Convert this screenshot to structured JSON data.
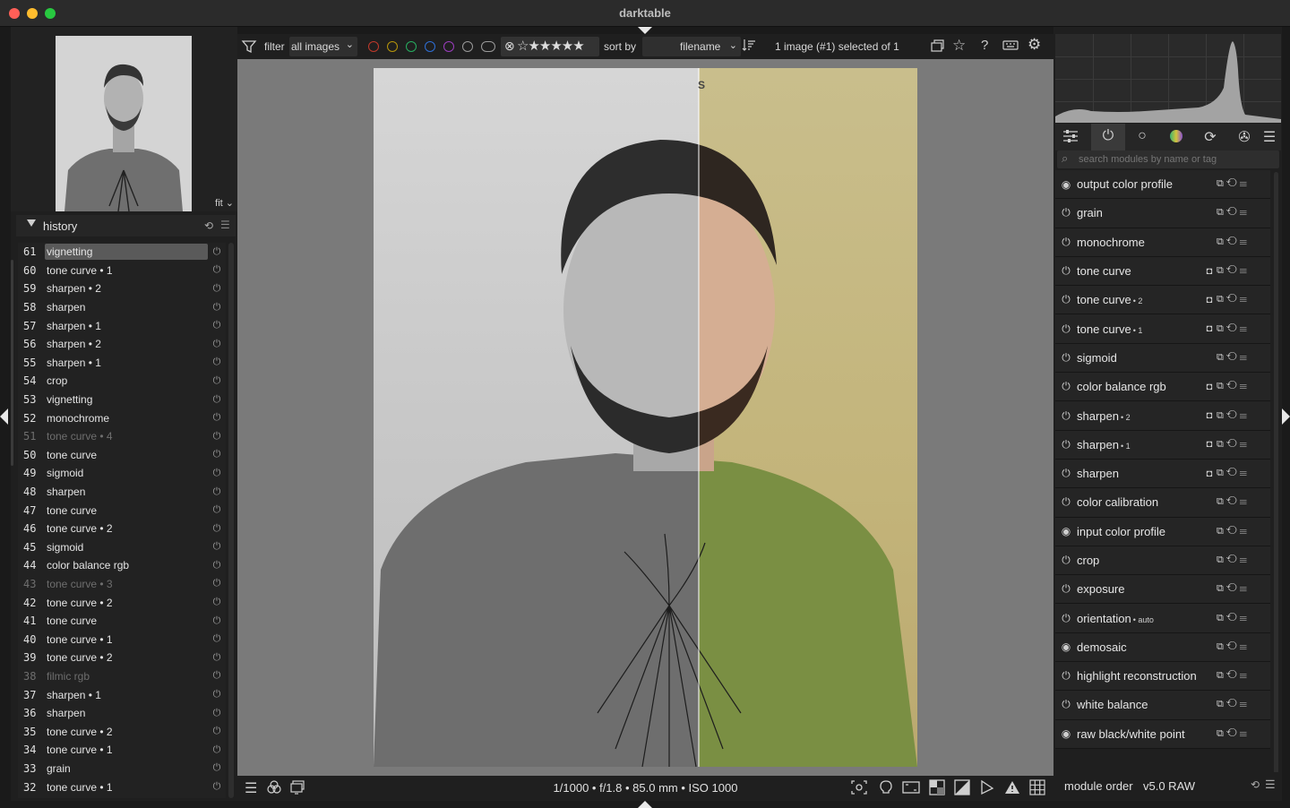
{
  "window": {
    "title": "darktable"
  },
  "navigator": {
    "zoom": "fit"
  },
  "history": {
    "title": "history",
    "items": [
      {
        "num": "61",
        "label": "vignetting",
        "state": "sel"
      },
      {
        "num": "60",
        "label": "tone curve • 1",
        "state": ""
      },
      {
        "num": "59",
        "label": "sharpen • 2",
        "state": ""
      },
      {
        "num": "58",
        "label": "sharpen",
        "state": ""
      },
      {
        "num": "57",
        "label": "sharpen • 1",
        "state": ""
      },
      {
        "num": "56",
        "label": "sharpen • 2",
        "state": ""
      },
      {
        "num": "55",
        "label": "sharpen • 1",
        "state": ""
      },
      {
        "num": "54",
        "label": "crop",
        "state": ""
      },
      {
        "num": "53",
        "label": "vignetting",
        "state": ""
      },
      {
        "num": "52",
        "label": "monochrome",
        "state": ""
      },
      {
        "num": "51",
        "label": "tone curve • 4",
        "state": "dim"
      },
      {
        "num": "50",
        "label": "tone curve",
        "state": ""
      },
      {
        "num": "49",
        "label": "sigmoid",
        "state": ""
      },
      {
        "num": "48",
        "label": "sharpen",
        "state": ""
      },
      {
        "num": "47",
        "label": "tone curve",
        "state": ""
      },
      {
        "num": "46",
        "label": "tone curve • 2",
        "state": ""
      },
      {
        "num": "45",
        "label": "sigmoid",
        "state": ""
      },
      {
        "num": "44",
        "label": "color balance rgb",
        "state": ""
      },
      {
        "num": "43",
        "label": "tone curve • 3",
        "state": "dim"
      },
      {
        "num": "42",
        "label": "tone curve • 2",
        "state": ""
      },
      {
        "num": "41",
        "label": "tone curve",
        "state": ""
      },
      {
        "num": "40",
        "label": "tone curve • 1",
        "state": ""
      },
      {
        "num": "39",
        "label": "tone curve • 2",
        "state": ""
      },
      {
        "num": "38",
        "label": "filmic rgb",
        "state": "dim"
      },
      {
        "num": "37",
        "label": "sharpen • 1",
        "state": ""
      },
      {
        "num": "36",
        "label": "sharpen",
        "state": ""
      },
      {
        "num": "35",
        "label": "tone curve • 2",
        "state": ""
      },
      {
        "num": "34",
        "label": "tone curve • 1",
        "state": ""
      },
      {
        "num": "33",
        "label": "grain",
        "state": ""
      },
      {
        "num": "32",
        "label": "tone curve • 1",
        "state": ""
      }
    ]
  },
  "toolbar": {
    "filter_label": "filter",
    "filter_value": "all images",
    "color_labels": [
      "#c0392b",
      "#b7950b",
      "#27ae60",
      "#2e6fd6",
      "#9b3dbf",
      "#9a9a9a",
      "#9a9a9a"
    ],
    "rating_stars": "☆★★★★★",
    "sortby_label": "sort by",
    "sort_value": "filename",
    "selection_status": "1 image (#1) selected of 1"
  },
  "image": {
    "split_label": "S"
  },
  "bottom_bar": {
    "exif": "1/1000 • f/1.8 • 85.0 mm • ISO 1000"
  },
  "search": {
    "placeholder": "search modules by name or tag"
  },
  "modules": [
    {
      "name": "output color profile",
      "inst": "",
      "always_on": true,
      "mask": false
    },
    {
      "name": "grain",
      "inst": "",
      "always_on": false,
      "mask": false
    },
    {
      "name": "monochrome",
      "inst": "",
      "always_on": false,
      "mask": false
    },
    {
      "name": "tone curve",
      "inst": "",
      "always_on": false,
      "mask": true
    },
    {
      "name": "tone curve",
      "inst": "• 2",
      "always_on": false,
      "mask": true
    },
    {
      "name": "tone curve",
      "inst": "• 1",
      "always_on": false,
      "mask": true
    },
    {
      "name": "sigmoid",
      "inst": "",
      "always_on": false,
      "mask": false
    },
    {
      "name": "color balance rgb",
      "inst": "",
      "always_on": false,
      "mask": true
    },
    {
      "name": "sharpen",
      "inst": "• 2",
      "always_on": false,
      "mask": true
    },
    {
      "name": "sharpen",
      "inst": "• 1",
      "always_on": false,
      "mask": true
    },
    {
      "name": "sharpen",
      "inst": "",
      "always_on": false,
      "mask": true
    },
    {
      "name": "color calibration",
      "inst": "",
      "always_on": false,
      "mask": false
    },
    {
      "name": "input color profile",
      "inst": "",
      "always_on": true,
      "mask": false
    },
    {
      "name": "crop",
      "inst": "",
      "always_on": false,
      "mask": false
    },
    {
      "name": "exposure",
      "inst": "",
      "always_on": false,
      "mask": false
    },
    {
      "name": "orientation",
      "inst": "• auto",
      "always_on": false,
      "mask": false
    },
    {
      "name": "demosaic",
      "inst": "",
      "always_on": true,
      "mask": false
    },
    {
      "name": "highlight reconstruction",
      "inst": "",
      "always_on": false,
      "mask": false
    },
    {
      "name": "white balance",
      "inst": "",
      "always_on": false,
      "mask": false
    },
    {
      "name": "raw black/white point",
      "inst": "",
      "always_on": true,
      "mask": false
    }
  ],
  "module_order": {
    "label": "module order",
    "value": "v5.0 RAW"
  },
  "colors": {
    "bg": "#1a1a1a",
    "panel": "#1f1f1f",
    "center": "#7a7a7a",
    "selected_row": "#5a5a5a"
  }
}
